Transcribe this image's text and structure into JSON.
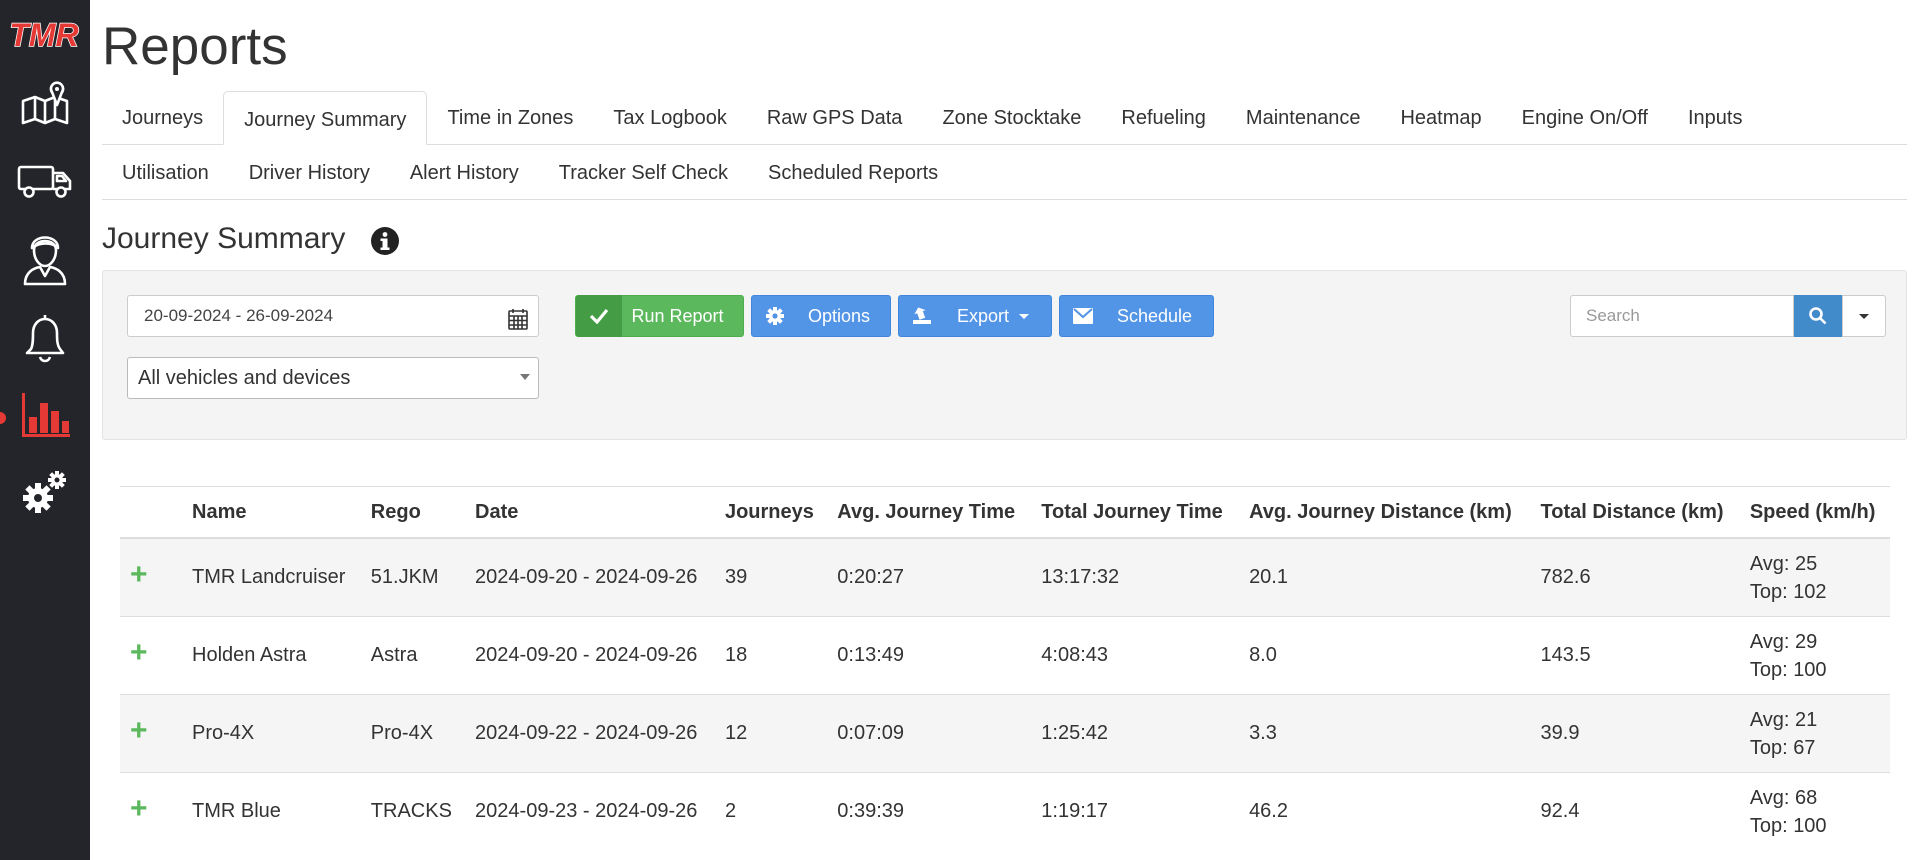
{
  "app": {
    "logo_text": "TMR"
  },
  "sidebar": {
    "items": [
      {
        "icon": "map-icon"
      },
      {
        "icon": "truck-icon"
      },
      {
        "icon": "driver-icon"
      },
      {
        "icon": "bell-icon"
      },
      {
        "icon": "bar-chart-icon",
        "active": true
      },
      {
        "icon": "gears-icon"
      }
    ]
  },
  "header": {
    "title": "Reports"
  },
  "tabs": {
    "row1": [
      "Journeys",
      "Journey Summary",
      "Time in Zones",
      "Tax Logbook",
      "Raw GPS Data",
      "Zone Stocktake",
      "Refueling",
      "Maintenance",
      "Heatmap",
      "Engine On/Off",
      "Inputs"
    ],
    "row2": [
      "Utilisation",
      "Driver History",
      "Alert History",
      "Tracker Self Check",
      "Scheduled Reports"
    ],
    "active": "Journey Summary"
  },
  "section": {
    "title": "Journey Summary"
  },
  "filters": {
    "date_range": "20-09-2024 - 26-09-2024",
    "vehicle_select": "All vehicles and devices"
  },
  "toolbar": {
    "run_label": "Run Report",
    "options_label": "Options",
    "export_label": "Export",
    "schedule_label": "Schedule",
    "search_placeholder": "Search"
  },
  "colors": {
    "sidebar_bg": "#23252b",
    "success": "#5cb85c",
    "primary": "#5294e5",
    "active_icon": "#e53935"
  },
  "table": {
    "headers": [
      "Name",
      "Rego",
      "Date",
      "Journeys",
      "Avg. Journey Time",
      "Total Journey Time",
      "Avg. Journey Distance (km)",
      "Total Distance (km)",
      "Speed (km/h)"
    ],
    "rows": [
      {
        "name": "TMR Landcruiser",
        "rego": "51.JKM",
        "date": "2024-09-20 - 2024-09-26",
        "journeys": "39",
        "avg_time": "0:20:27",
        "total_time": "13:17:32",
        "avg_dist": "20.1",
        "total_dist": "782.6",
        "speed_avg": "Avg: 25",
        "speed_top": "Top: 102"
      },
      {
        "name": "Holden Astra",
        "rego": "Astra",
        "date": "2024-09-20 - 2024-09-26",
        "journeys": "18",
        "avg_time": "0:13:49",
        "total_time": "4:08:43",
        "avg_dist": "8.0",
        "total_dist": "143.5",
        "speed_avg": "Avg: 29",
        "speed_top": "Top: 100"
      },
      {
        "name": "Pro-4X",
        "rego": "Pro-4X",
        "date": "2024-09-22 - 2024-09-26",
        "journeys": "12",
        "avg_time": "0:07:09",
        "total_time": "1:25:42",
        "avg_dist": "3.3",
        "total_dist": "39.9",
        "speed_avg": "Avg: 21",
        "speed_top": "Top: 67"
      },
      {
        "name": "TMR Blue",
        "rego": "TRACKS",
        "date": "2024-09-23 - 2024-09-26",
        "journeys": "2",
        "avg_time": "0:39:39",
        "total_time": "1:19:17",
        "avg_dist": "46.2",
        "total_dist": "92.4",
        "speed_avg": "Avg: 68",
        "speed_top": "Top: 100"
      }
    ]
  }
}
